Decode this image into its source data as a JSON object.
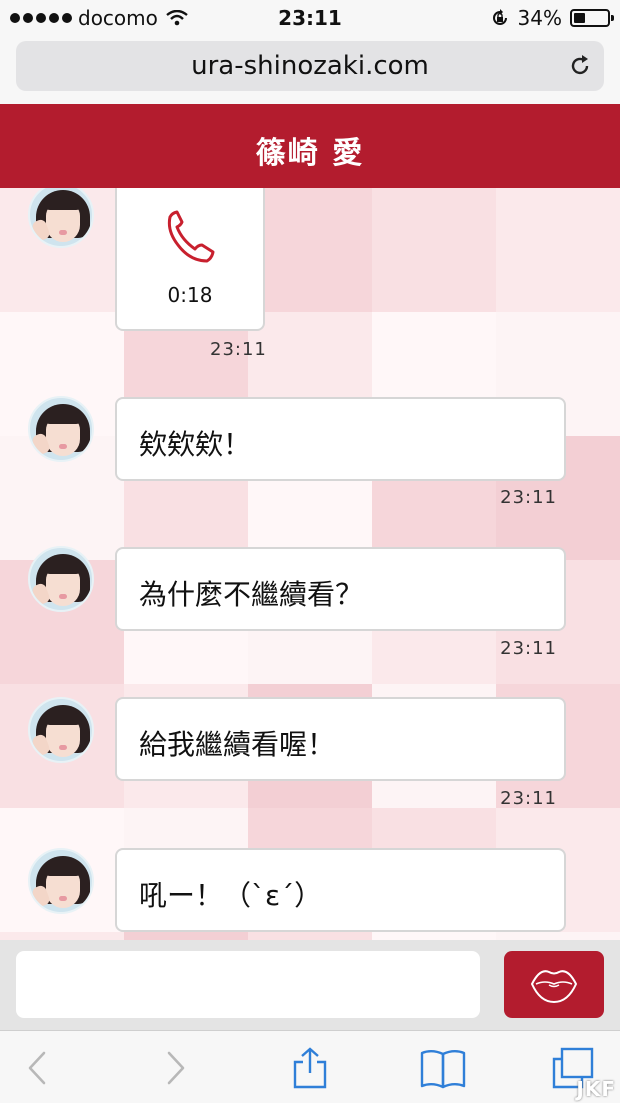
{
  "status_bar": {
    "carrier": "docomo",
    "time": "23:11",
    "battery": "34%",
    "battery_level": 0.34
  },
  "browser": {
    "url": "ura-shinozaki.com"
  },
  "header": {
    "title": "篠崎 愛"
  },
  "messages": {
    "call": {
      "duration": "0:18",
      "time": "23:11"
    },
    "items": [
      {
        "text": "欸欸欸！",
        "time": "23:11"
      },
      {
        "text": "為什麼不繼續看？",
        "time": "23:11"
      },
      {
        "text": "給我繼續看喔！",
        "time": "23:11"
      },
      {
        "text": "吼ー！（`ε´）"
      }
    ]
  },
  "composer": {
    "placeholder": "",
    "send_icon": "lips-icon"
  },
  "colors": {
    "accent": "#b31c2e",
    "chat_background": "#fbeff0"
  },
  "watermark": "JKF"
}
